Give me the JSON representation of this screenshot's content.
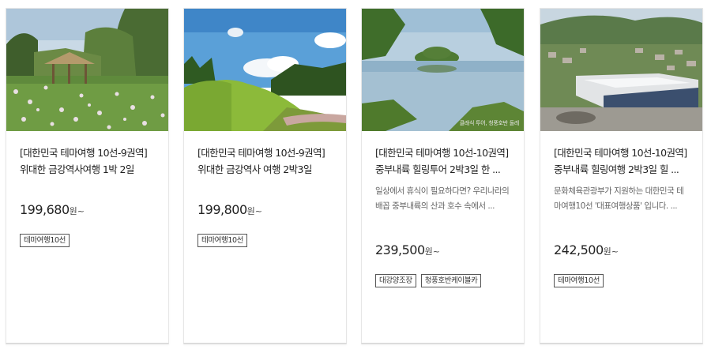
{
  "products": [
    {
      "image_alt": "연꽃 정원과 초가 정자",
      "title_line1": "[대한민국 테마여행 10선-9권역]",
      "title_line2": "위대한 금강역사여행 1박 2일",
      "description_line1": "",
      "description_line2": "",
      "price": "199,680",
      "price_unit": "원~",
      "tags": [
        "테마여행10선"
      ]
    },
    {
      "image_alt": "푸른 잔디 고분 언덕",
      "title_line1": "[대한민국 테마여행 10선-9권역]",
      "title_line2": "위대한 금강역사 여행 2박3일",
      "description_line1": "",
      "description_line2": "",
      "price": "199,800",
      "price_unit": "원~",
      "tags": [
        "테마여행10선"
      ]
    },
    {
      "image_alt": "호수와 작은 섬",
      "image_caption": "클래식 투어, 청풍호반 둘레",
      "title_line1": "[대한민국 테마여행 10선-10권역]",
      "title_line2": "중부내륙 힐링투어 2박3일 한 ...",
      "description_line1": "일상에서 휴식이 필요하다면? 우리나라의",
      "description_line2": "배꼽 중부내륙의 산과 호수 속에서 ...",
      "price": "239,500",
      "price_unit": "원~",
      "tags": [
        "대강양조장",
        "청풍호반케이블카"
      ]
    },
    {
      "image_alt": "마을 속 현대식 건물 항공사진",
      "title_line1": "[대한민국 테마여행 10선-10권역]",
      "title_line2": "중부내륙 힐링여행 2박3일 힐 ...",
      "description_line1": "문화체육관광부가 지원하는 대한민국 테",
      "description_line2": "마여행10선 '대표여행상품' 입니다. ...",
      "price": "242,500",
      "price_unit": "원~",
      "tags": [
        "테마여행10선"
      ]
    }
  ]
}
